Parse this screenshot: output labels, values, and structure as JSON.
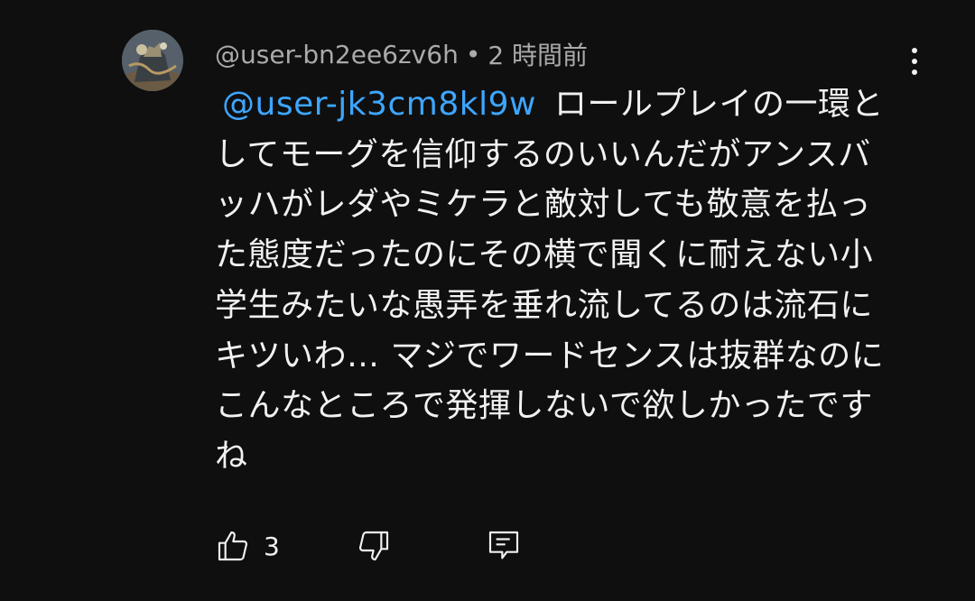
{
  "comment": {
    "author": "@user-bn2ee6zv6h",
    "separator": "•",
    "timestamp": "2 時間前",
    "mention": "@user-jk3cm8kl9w",
    "text": "ロールプレイの一環としてモーグを信仰するのいいんだがアンスバッハがレダやミケラと敵対しても敬意を払った態度だったのにその横で聞くに耐えない小学生みたいな愚弄を垂れ流してるのは流石にキツいわ… マジでワードセンスは抜群なのにこんなところで発揮しないで欲しかったですね",
    "like_count": "3"
  },
  "icons": {
    "more": "more-vertical-icon",
    "like": "thumbs-up-icon",
    "dislike": "thumbs-down-icon",
    "reply": "reply-comment-icon"
  },
  "colors": {
    "background": "#0f0f0f",
    "text": "#f1f1f1",
    "secondary_text": "#aaaaaa",
    "mention": "#3ea6ff"
  }
}
